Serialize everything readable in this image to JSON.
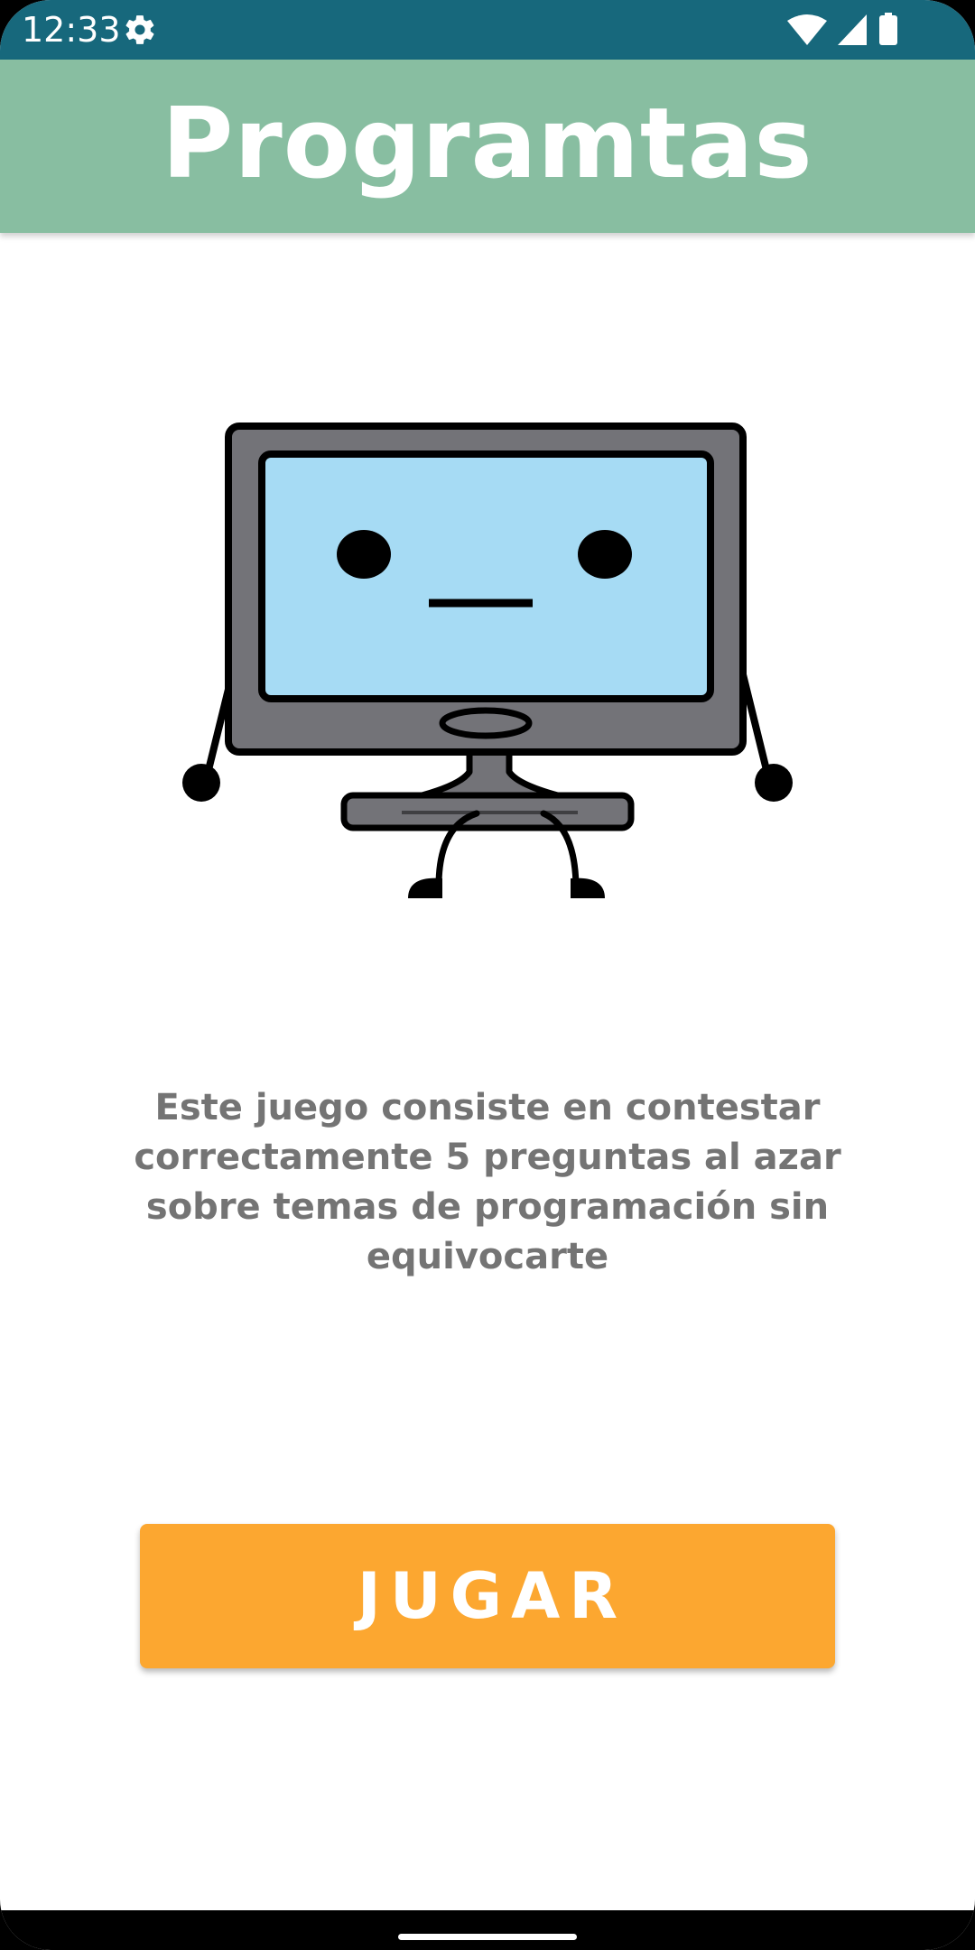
{
  "status_bar": {
    "time": "12:33",
    "icons": [
      "gear-icon",
      "wifi-icon",
      "signal-icon",
      "battery-icon"
    ],
    "color": "#17687c"
  },
  "app_bar": {
    "title": "Programtas",
    "color": "#88bea1"
  },
  "illustration": {
    "icon": "computer-character-icon",
    "screen_color": "#a6dbf4",
    "body_color": "#737378"
  },
  "description": "Este juego consiste en contestar correctamente 5 preguntas al azar sobre temas de programación sin equivocarte",
  "play_button": {
    "label": "JUGAR",
    "color": "#fca730"
  },
  "navigation": {
    "icons": [
      "home-handle"
    ]
  }
}
